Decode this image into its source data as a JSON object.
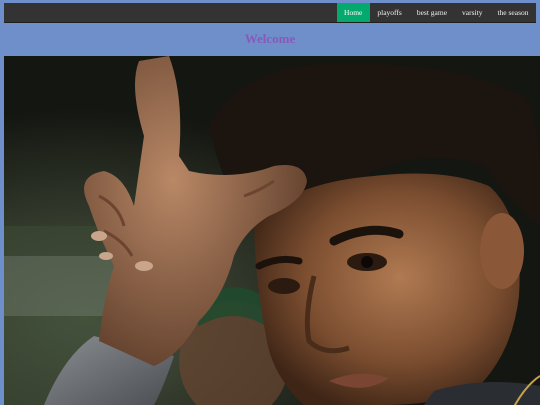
{
  "nav": {
    "items": [
      {
        "label": "Home",
        "active": true
      },
      {
        "label": "playoffs",
        "active": false
      },
      {
        "label": "best game",
        "active": false
      },
      {
        "label": "varsity",
        "active": false
      },
      {
        "label": "the season",
        "active": false
      }
    ]
  },
  "main": {
    "heading": "Welcome"
  },
  "hero": {
    "subject": "photo of young man making L hand sign on forehead"
  },
  "colors": {
    "page_background": "#6f8fca",
    "navbar_background": "#333333",
    "active_tab": "#04aa6d",
    "heading": "#8a58b8"
  }
}
